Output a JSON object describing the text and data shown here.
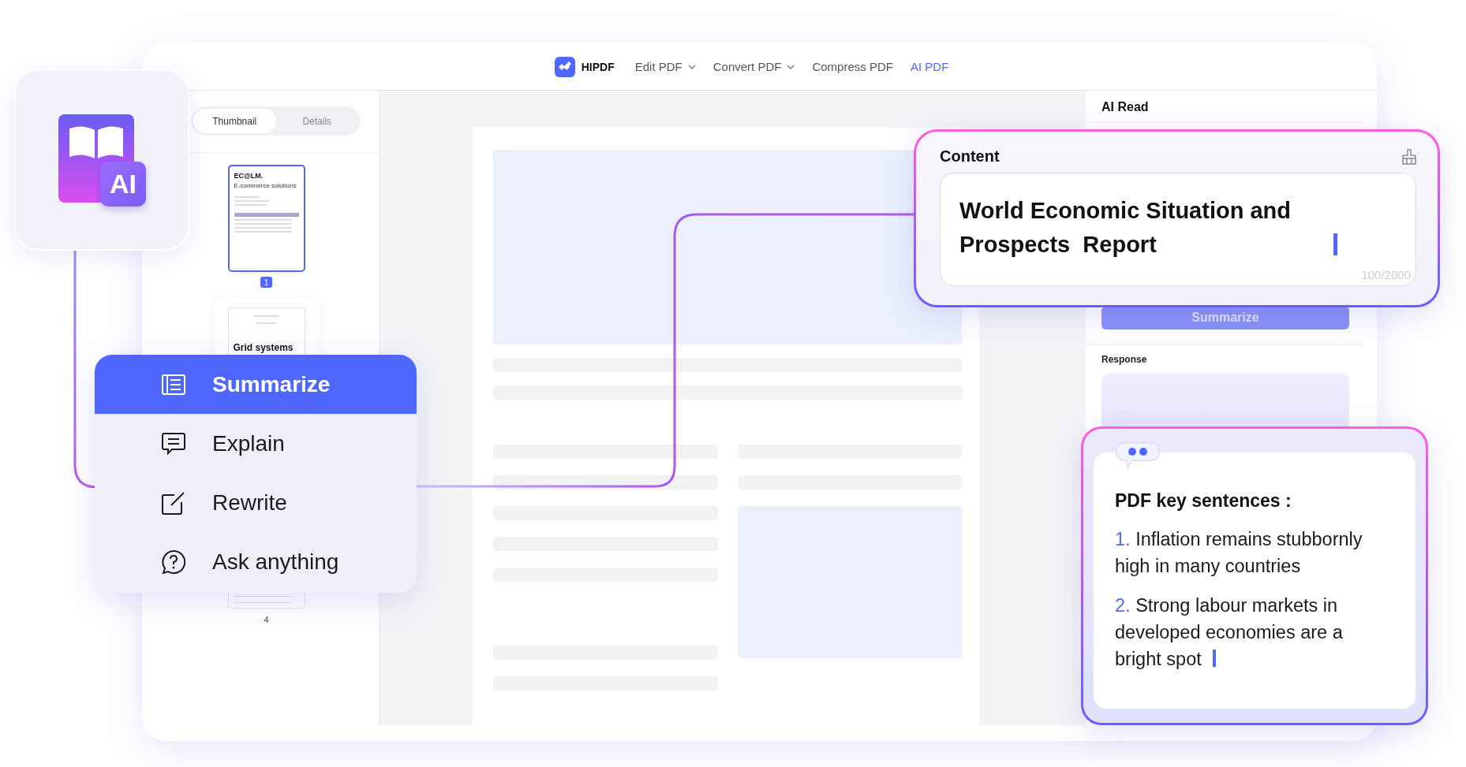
{
  "logo_card": {
    "badge": "AI"
  },
  "nav": {
    "brand": "HIPDF",
    "items": [
      {
        "label": "Edit PDF",
        "dropdown": true,
        "selected": false
      },
      {
        "label": "Convert PDF",
        "dropdown": true,
        "selected": false
      },
      {
        "label": "Compress PDF",
        "dropdown": false,
        "selected": false
      },
      {
        "label": "AI PDF",
        "dropdown": false,
        "selected": true
      }
    ]
  },
  "sidebar": {
    "tabs": [
      {
        "label": "Thumbnail",
        "selected": true
      },
      {
        "label": "Details",
        "selected": false
      }
    ],
    "pages": [
      {
        "kind": "invoice",
        "title": "EC@LM.",
        "subtitle": "E-commerce solutions",
        "number": "1",
        "selected": true
      },
      {
        "kind": "article",
        "title": "Grid systems",
        "selected": false
      },
      {
        "kind": "table",
        "number": "4",
        "selected": false
      }
    ]
  },
  "ai_panel": {
    "title": "AI Read",
    "button": "Summarize",
    "response_label": "Response"
  },
  "menu": {
    "items": [
      {
        "label": "Summarize",
        "kind": "list",
        "selected": true
      },
      {
        "label": "Explain",
        "kind": "comment",
        "selected": false
      },
      {
        "label": "Rewrite",
        "kind": "edit",
        "selected": false
      },
      {
        "label": "Ask anything",
        "kind": "question",
        "selected": false
      }
    ]
  },
  "content_card": {
    "title": "Content",
    "value": "World Economic Situation and Prospects  Report",
    "counter": "100/2000"
  },
  "key_card": {
    "title": "PDF key sentences :",
    "items": [
      {
        "number": "1.",
        "text": "Inflation remains stubbornly high in many countries"
      },
      {
        "number": "2.",
        "text": "Strong labour markets in developed economies are a bright spot"
      }
    ]
  }
}
